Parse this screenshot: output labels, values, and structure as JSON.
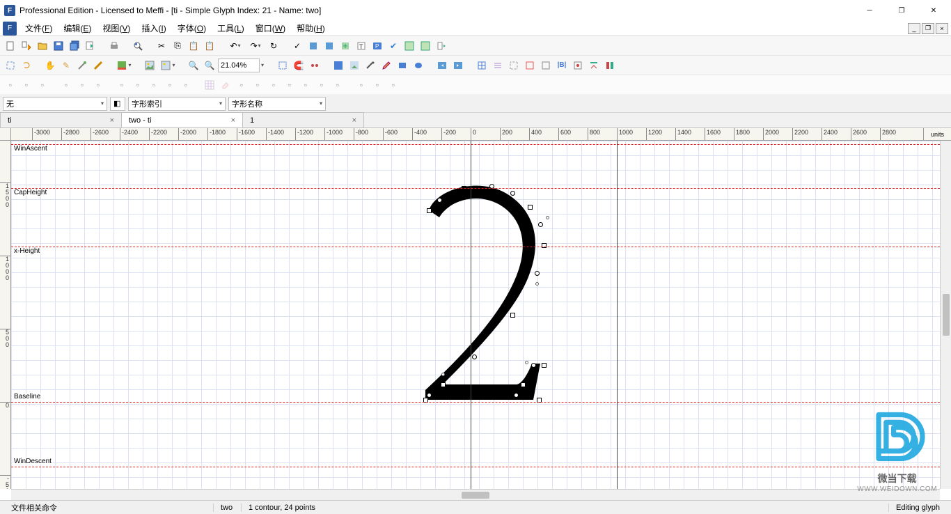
{
  "titlebar": "Professional Edition - Licensed to Meffi - [ti - Simple Glyph Index: 21 - Name: two]",
  "menu": [
    {
      "label": "文件",
      "key": "F"
    },
    {
      "label": "编辑",
      "key": "E"
    },
    {
      "label": "视图",
      "key": "V"
    },
    {
      "label": "插入",
      "key": "I"
    },
    {
      "label": "字体",
      "key": "O"
    },
    {
      "label": "工具",
      "key": "L"
    },
    {
      "label": "窗口",
      "key": "W"
    },
    {
      "label": "帮助",
      "key": "H"
    }
  ],
  "zoom": "21.04%",
  "combos": {
    "layer": "无",
    "glyphIndexLabel": "字形索引",
    "glyphNameLabel": "字形名称"
  },
  "tabs": [
    {
      "label": "ti",
      "active": false
    },
    {
      "label": "two - ti",
      "active": true
    },
    {
      "label": "1",
      "active": false
    }
  ],
  "ruler": {
    "units_label": "units",
    "h_ticks": [
      -3000,
      -2800,
      -2600,
      -2400,
      -2200,
      -2000,
      -1800,
      -1600,
      -1400,
      -1200,
      -1000,
      -800,
      -600,
      -400,
      -200,
      0,
      200,
      400,
      600,
      800,
      1000,
      1200,
      1400,
      1600,
      1800,
      2000,
      2200,
      2400,
      2600,
      2800
    ],
    "v_ticks": [
      1500,
      1000,
      500,
      0,
      -500
    ]
  },
  "metrics": {
    "winascent": "WinAscent",
    "capheight": "CapHeight",
    "xheight": "x-Height",
    "baseline": "Baseline",
    "windescent": "WinDescent"
  },
  "status": {
    "left": "文件相关命令",
    "glyph": "two",
    "contour": "1 contour, 24 points",
    "right": "Editing glyph"
  },
  "watermark": {
    "text": "微当下载",
    "url": "WWW.WEIDOWN.COM"
  },
  "chart_data": {
    "type": "glyph",
    "glyph_name": "two",
    "glyph_index": 21,
    "advance_width": 1000,
    "contours": 1,
    "n_points": 24,
    "metrics_values": {
      "WinAscent": 1800,
      "CapHeight": 1460,
      "xHeight": 1060,
      "Baseline": 0,
      "WinDescent": -450
    }
  }
}
